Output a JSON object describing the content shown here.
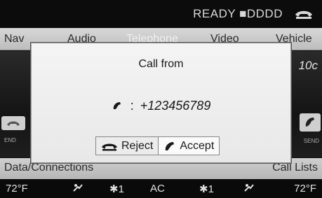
{
  "status": {
    "text": "READY ■DDDD",
    "phone_icon": "phone-hang-icon"
  },
  "main_menu": {
    "nav": "Nav",
    "audio": "Audio",
    "telephone": "Telephone",
    "video": "Video",
    "vehicle": "Vehicle"
  },
  "background": {
    "number_fragment": "10c",
    "end_label": "END",
    "send_label": "SEND"
  },
  "bottom_menu": {
    "left": "Data/Connections",
    "right": "Call Lists"
  },
  "climate": {
    "temp_left": "72°F",
    "fan_left": "✱1",
    "ac": "AC",
    "fan_right": "✱1",
    "temp_right": "72°F"
  },
  "dialog": {
    "title": "Call from",
    "separator": ":",
    "caller_number": "+123456789",
    "reject_label": "Reject",
    "accept_label": "Accept"
  },
  "colors": {
    "dialog_bg": "#f0f0f0",
    "menu_bg": "#c8c8c8",
    "screen_bg": "#101010"
  }
}
